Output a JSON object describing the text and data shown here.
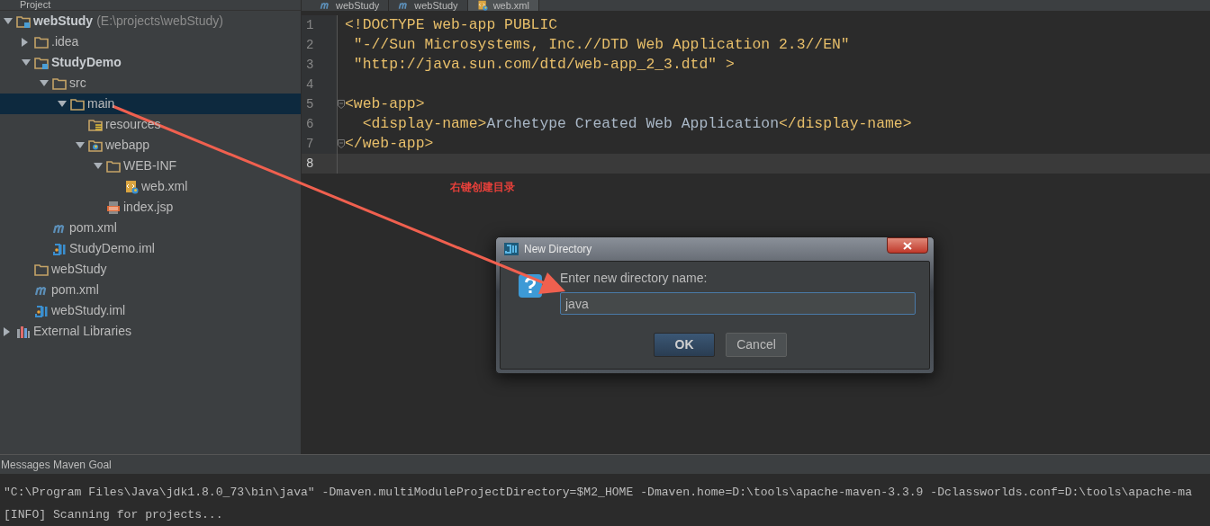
{
  "project_panel": {
    "title": "Project"
  },
  "editor_tabs": [
    {
      "label": "webStudy",
      "kind": "maven",
      "selected": false
    },
    {
      "label": "webStudy",
      "kind": "maven",
      "selected": false
    },
    {
      "label": "web.xml",
      "kind": "web-xml",
      "selected": true
    }
  ],
  "project_tree": [
    {
      "label": "webStudy",
      "path": "(E:\\projects\\webStudy)",
      "kind": "module",
      "bold": true,
      "expanded": true,
      "selected": false,
      "children": [
        {
          "label": ".idea",
          "kind": "folder",
          "bold": false,
          "expanded": false,
          "selected": false
        },
        {
          "label": "StudyDemo",
          "kind": "module",
          "bold": true,
          "expanded": true,
          "selected": false,
          "children": [
            {
              "label": "src",
              "kind": "folder",
              "bold": false,
              "expanded": true,
              "selected": false,
              "children": [
                {
                  "label": "main",
                  "kind": "folder",
                  "bold": false,
                  "expanded": true,
                  "selected": true,
                  "children": [
                    {
                      "label": "resources",
                      "kind": "resources",
                      "bold": false,
                      "selected": false
                    },
                    {
                      "label": "webapp",
                      "kind": "web-folder",
                      "bold": false,
                      "expanded": true,
                      "selected": false,
                      "children": [
                        {
                          "label": "WEB-INF",
                          "kind": "folder",
                          "bold": false,
                          "expanded": true,
                          "selected": false,
                          "children": [
                            {
                              "label": "web.xml",
                              "kind": "web-xml",
                              "bold": false,
                              "selected": false
                            }
                          ]
                        },
                        {
                          "label": "index.jsp",
                          "kind": "jsp",
                          "bold": false,
                          "selected": false
                        }
                      ]
                    }
                  ]
                }
              ]
            },
            {
              "label": "pom.xml",
              "kind": "maven",
              "bold": false,
              "selected": false
            },
            {
              "label": "StudyDemo.iml",
              "kind": "iml",
              "bold": false,
              "selected": false
            }
          ]
        },
        {
          "label": "webStudy",
          "kind": "folder",
          "bold": false,
          "selected": false
        },
        {
          "label": "pom.xml",
          "kind": "maven",
          "bold": false,
          "selected": false
        },
        {
          "label": "webStudy.iml",
          "kind": "iml",
          "bold": false,
          "selected": false
        }
      ]
    },
    {
      "label": "External Libraries",
      "kind": "libraries",
      "bold": false,
      "expanded": false,
      "selected": false
    }
  ],
  "code_lines": [
    {
      "number": "1",
      "fold": false,
      "current": false,
      "segments": [
        {
          "kind": "tag",
          "text": "<!DOCTYPE web-app PUBLIC"
        }
      ]
    },
    {
      "number": "2",
      "fold": false,
      "current": false,
      "segments": [
        {
          "kind": "tag",
          "text": " \"-//Sun Microsystems, Inc.//DTD Web Application 2.3//EN\""
        }
      ]
    },
    {
      "number": "3",
      "fold": false,
      "current": false,
      "segments": [
        {
          "kind": "tag",
          "text": " \"http://java.sun.com/dtd/web-app_2_3.dtd\" >"
        }
      ]
    },
    {
      "number": "4",
      "fold": false,
      "current": false
    },
    {
      "number": "5",
      "fold": true,
      "current": false,
      "segments": [
        {
          "kind": "tag",
          "text": "<web-app>"
        }
      ]
    },
    {
      "number": "6",
      "fold": false,
      "current": false,
      "segments": [
        {
          "kind": "tag",
          "text": "  <display-name>"
        },
        {
          "kind": "text",
          "text": "Archetype Created Web Application"
        },
        {
          "kind": "tag",
          "text": "</display-name>"
        }
      ]
    },
    {
      "number": "7",
      "fold": true,
      "current": false,
      "segments": [
        {
          "kind": "tag",
          "text": "</web-app>"
        }
      ]
    },
    {
      "number": "8",
      "fold": false,
      "current": true
    }
  ],
  "annotation": {
    "text": "右键创建目录"
  },
  "dialog": {
    "title": "New Directory",
    "prompt": "Enter new directory name:",
    "value": "java",
    "buttons": [
      {
        "label": "OK",
        "default": true
      },
      {
        "label": "Cancel",
        "default": false
      }
    ]
  },
  "bottom_panel": {
    "title": "Messages Maven Goal",
    "lines": [
      "\"C:\\Program Files\\Java\\jdk1.8.0_73\\bin\\java\" -Dmaven.multiModuleProjectDirectory=$M2_HOME -Dmaven.home=D:\\tools\\apache-maven-3.3.9 -Dclassworlds.conf=D:\\tools\\apache-ma",
      "[INFO] Scanning for projects..."
    ]
  }
}
